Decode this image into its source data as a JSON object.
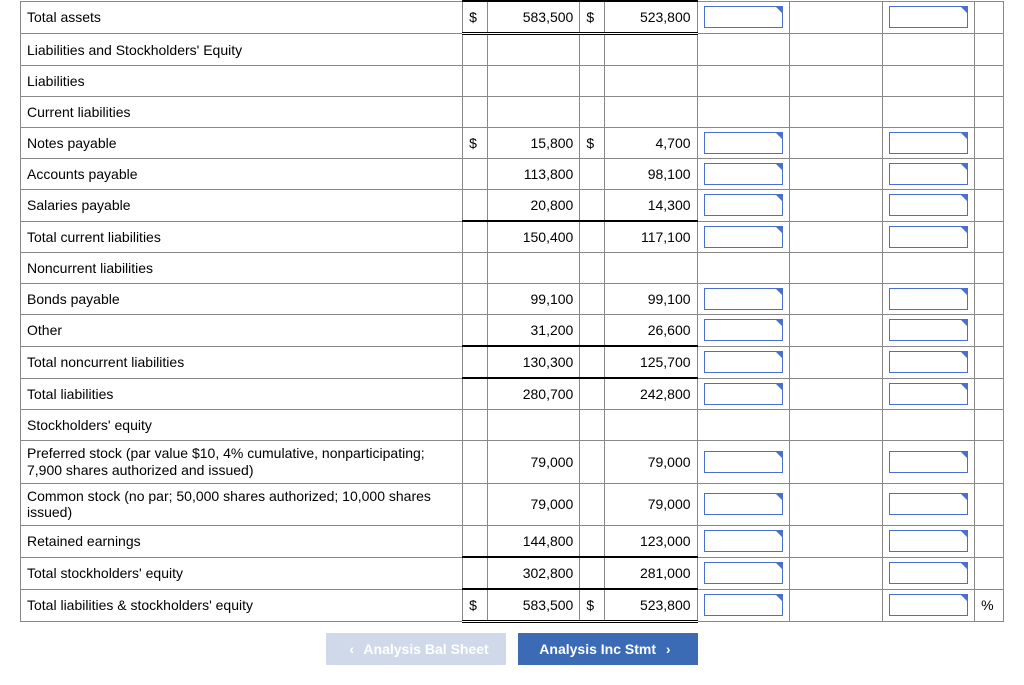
{
  "rows": {
    "total_assets": {
      "label": "Total assets",
      "c1": "$",
      "v1": "583,500",
      "c2": "$",
      "v2": "523,800"
    },
    "liab_eq_hdr": {
      "label": "Liabilities and Stockholders' Equity"
    },
    "liab_hdr": {
      "label": "Liabilities"
    },
    "cur_liab_hdr": {
      "label": "Current liabilities"
    },
    "notes_payable": {
      "label": "Notes payable",
      "c1": "$",
      "v1": "15,800",
      "c2": "$",
      "v2": "4,700"
    },
    "accounts_payable": {
      "label": "Accounts payable",
      "v1": "113,800",
      "v2": "98,100"
    },
    "salaries_payable": {
      "label": "Salaries payable",
      "v1": "20,800",
      "v2": "14,300"
    },
    "total_cur_liab": {
      "label": "Total current liabilities",
      "v1": "150,400",
      "v2": "117,100"
    },
    "noncur_liab_hdr": {
      "label": "Noncurrent liabilities"
    },
    "bonds_payable": {
      "label": "Bonds payable",
      "v1": "99,100",
      "v2": "99,100"
    },
    "other": {
      "label": "Other",
      "v1": "31,200",
      "v2": "26,600"
    },
    "total_noncur_liab": {
      "label": "Total noncurrent liabilities",
      "v1": "130,300",
      "v2": "125,700"
    },
    "total_liab": {
      "label": "Total liabilities",
      "v1": "280,700",
      "v2": "242,800"
    },
    "se_hdr": {
      "label": "Stockholders' equity"
    },
    "pref_stock": {
      "label": "Preferred stock (par value $10, 4% cumulative, nonparticipating; 7,900 shares authorized and issued)",
      "v1": "79,000",
      "v2": "79,000"
    },
    "common_stock": {
      "label": "Common stock (no par; 50,000 shares authorized; 10,000 shares issued)",
      "v1": "79,000",
      "v2": "79,000"
    },
    "retained_earnings": {
      "label": "Retained earnings",
      "v1": "144,800",
      "v2": "123,000"
    },
    "total_se": {
      "label": "Total stockholders' equity",
      "v1": "302,800",
      "v2": "281,000"
    },
    "total_liab_se": {
      "label": "Total liabilities & stockholders' equity",
      "c1": "$",
      "v1": "583,500",
      "c2": "$",
      "v2": "523,800"
    }
  },
  "pct_symbol": "%",
  "nav": {
    "prev": "Analysis Bal Sheet",
    "next": "Analysis Inc Stmt"
  }
}
